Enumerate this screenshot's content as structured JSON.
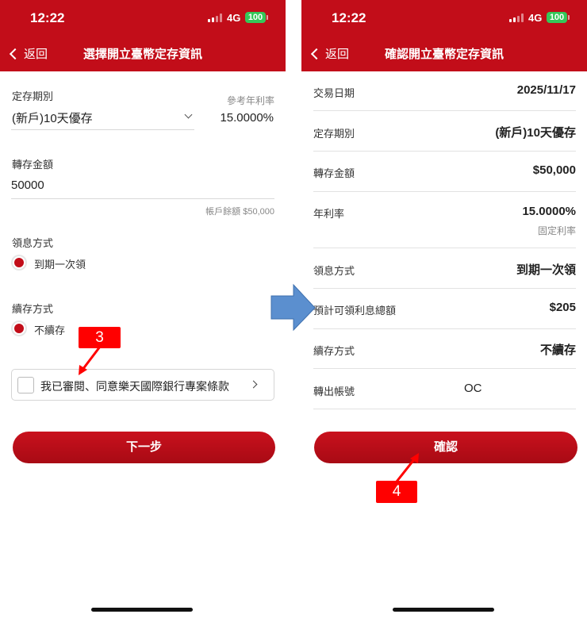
{
  "status": {
    "time": "12:22",
    "network": "4G",
    "battery": "100"
  },
  "left": {
    "back_label": "返回",
    "title": "選擇開立臺幣定存資訊",
    "term_label": "定存期別",
    "term_value": "(新戶)10天優存",
    "rate_label": "參考年利率",
    "rate_value": "15.0000%",
    "amount_label": "轉存金額",
    "amount_value": "50000",
    "balance_note": "帳戶餘額 $50,000",
    "interest_label": "領息方式",
    "interest_option": "到期一次領",
    "renew_label": "續存方式",
    "renew_option": "不續存",
    "agree_text": "我已審閱、同意樂天國際銀行專案條款",
    "next_button": "下一步"
  },
  "right": {
    "back_label": "返回",
    "title": "確認開立臺幣定存資訊",
    "rows": [
      {
        "key": "交易日期",
        "value": "2025/11/17"
      },
      {
        "key": "定存期別",
        "value": "(新戶)10天優存"
      },
      {
        "key": "轉存金額",
        "value": "$50,000"
      },
      {
        "key": "年利率",
        "value": "15.0000%",
        "sub": "固定利率"
      },
      {
        "key": "領息方式",
        "value": "到期一次領"
      },
      {
        "key": "預計可領利息總額",
        "value": "$205"
      },
      {
        "key": "續存方式",
        "value": "不續存"
      },
      {
        "key": "轉出帳號",
        "value": "OC"
      }
    ],
    "confirm_button": "確認"
  },
  "annotations": {
    "step3": "3",
    "step4": "4",
    "accent": "#ff0000",
    "brand": "#c20d19",
    "flow_arrow_color": "#5b8fcf"
  }
}
